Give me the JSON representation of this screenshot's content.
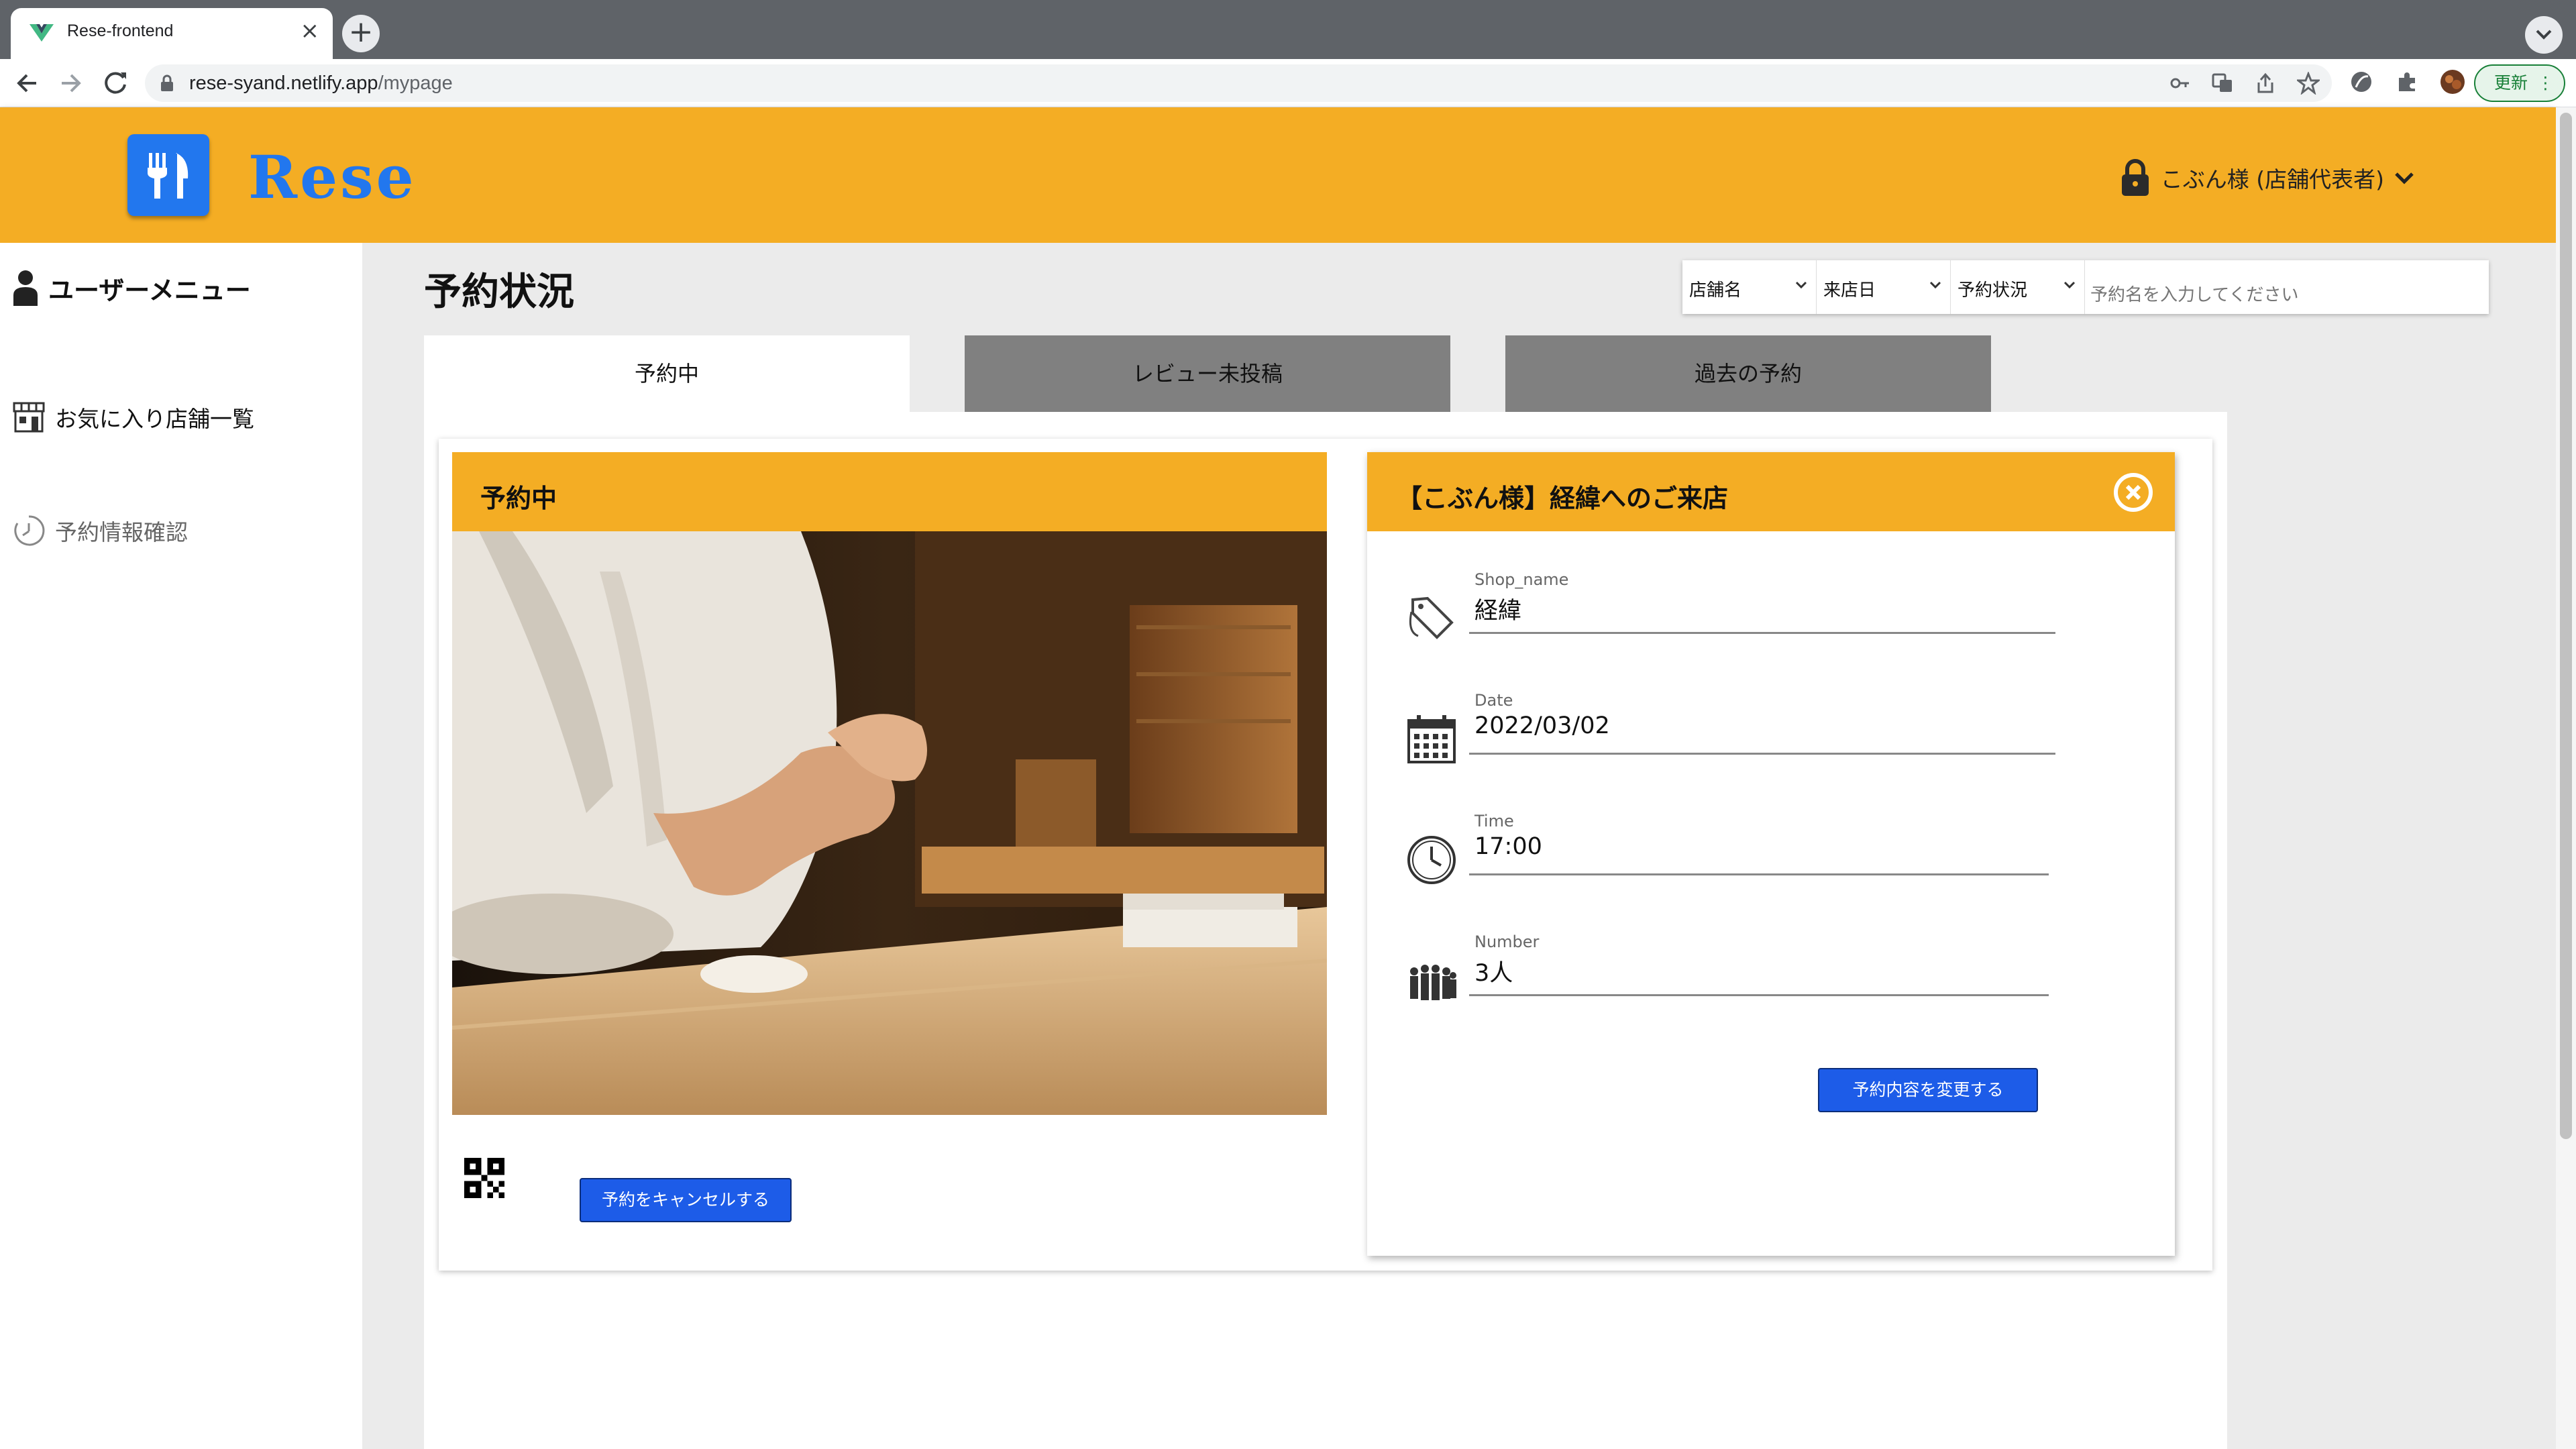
{
  "browser": {
    "tab_title": "Rese-frontend",
    "tab_close": "×",
    "new_tab": "+",
    "url_host": "rese-syand.netlify.app",
    "url_path": "/mypage",
    "update_label": "更新"
  },
  "header": {
    "logo": "Rese",
    "user_name": "こぶん様 (店舗代表者)",
    "brand_color": "#2277ee",
    "accent_color": "#f4ad24"
  },
  "sidebar": {
    "items": [
      {
        "label": "ユーザーメニュー",
        "icon": "user-icon"
      },
      {
        "label": "お気に入り店舗一覧",
        "icon": "store-icon"
      },
      {
        "label": "予約情報確認",
        "icon": "history-icon"
      }
    ]
  },
  "main": {
    "title": "予約状況",
    "filters": {
      "shop": "店舗名",
      "date": "来店日",
      "status": "予約状況",
      "placeholder": "予約名を入力してください"
    },
    "tabs": [
      {
        "label": "予約中",
        "active": true
      },
      {
        "label": "レビュー未投稿",
        "active": false
      },
      {
        "label": "過去の予約",
        "active": false
      }
    ],
    "reservation_card": {
      "title": "予約中",
      "cancel_label": "予約をキャンセルする"
    },
    "detail": {
      "title": "【こぶん様】経緯へのご来店",
      "fields": [
        {
          "label": "Shop_name",
          "value": "経緯",
          "icon": "tag-icon"
        },
        {
          "label": "Date",
          "value": "2022/03/02",
          "icon": "calendar-icon"
        },
        {
          "label": "Time",
          "value": "17:00",
          "icon": "clock-icon"
        },
        {
          "label": "Number",
          "value": "3人",
          "icon": "people-icon"
        }
      ],
      "change_label": "予約内容を変更する"
    }
  }
}
